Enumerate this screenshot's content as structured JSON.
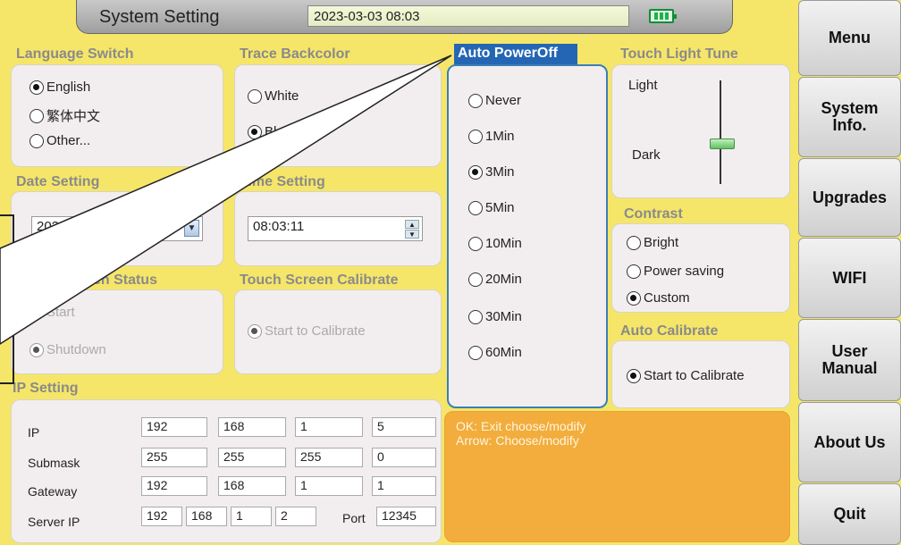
{
  "header": {
    "title": "System Setting",
    "datetime": "2023-03-03 08:03"
  },
  "language": {
    "title": "Language Switch",
    "options": [
      "English",
      "繁体中文",
      "Other..."
    ],
    "selected": 0
  },
  "trace": {
    "title": "Trace Backcolor",
    "options": [
      "White",
      "Black"
    ],
    "selected": 1
  },
  "power": {
    "title": "Auto PowerOff",
    "options": [
      "Never",
      "1Min",
      "3Min",
      "5Min",
      "10Min",
      "20Min",
      "30Min",
      "60Min"
    ],
    "selected": 2
  },
  "touchlight": {
    "title": "Touch Light Tune",
    "light_label": "Light",
    "dark_label": "Dark"
  },
  "date": {
    "title": "Date Setting",
    "value": "2023-03-03"
  },
  "time": {
    "title": "Time Setting",
    "value": "08:03:11"
  },
  "contrast": {
    "title": "Contrast",
    "options": [
      "Bright",
      "Power saving",
      "Custom"
    ],
    "selected": 2
  },
  "touchstatus": {
    "title": "Touch Screen Status",
    "options": [
      "Start",
      "Shutdown"
    ],
    "selected": 1
  },
  "calibrate": {
    "title": "Touch Screen Calibrate",
    "label": "Start to Calibrate"
  },
  "autocal": {
    "title": "Auto Calibrate",
    "label": "Start to Calibrate"
  },
  "ip": {
    "title": "IP Setting",
    "rows": [
      {
        "label": "IP",
        "octets": [
          "192",
          "168",
          "1",
          "5"
        ]
      },
      {
        "label": "Submask",
        "octets": [
          "255",
          "255",
          "255",
          "0"
        ]
      },
      {
        "label": "Gateway",
        "octets": [
          "192",
          "168",
          "1",
          "1"
        ]
      }
    ],
    "server": {
      "label": "Server IP",
      "octets": [
        "192",
        "168",
        "1",
        "2"
      ],
      "port_label": "Port",
      "port": "12345"
    }
  },
  "info": {
    "line1": "OK: Exit choose/modify",
    "line2": "Arrow: Choose/modify"
  },
  "nav": {
    "menu": "Menu",
    "system_info": "System\nInfo.",
    "upgrades": "Upgrades",
    "wifi": "WIFI",
    "user_manual": "User\nManual",
    "about": "About Us",
    "quit": "Quit"
  }
}
